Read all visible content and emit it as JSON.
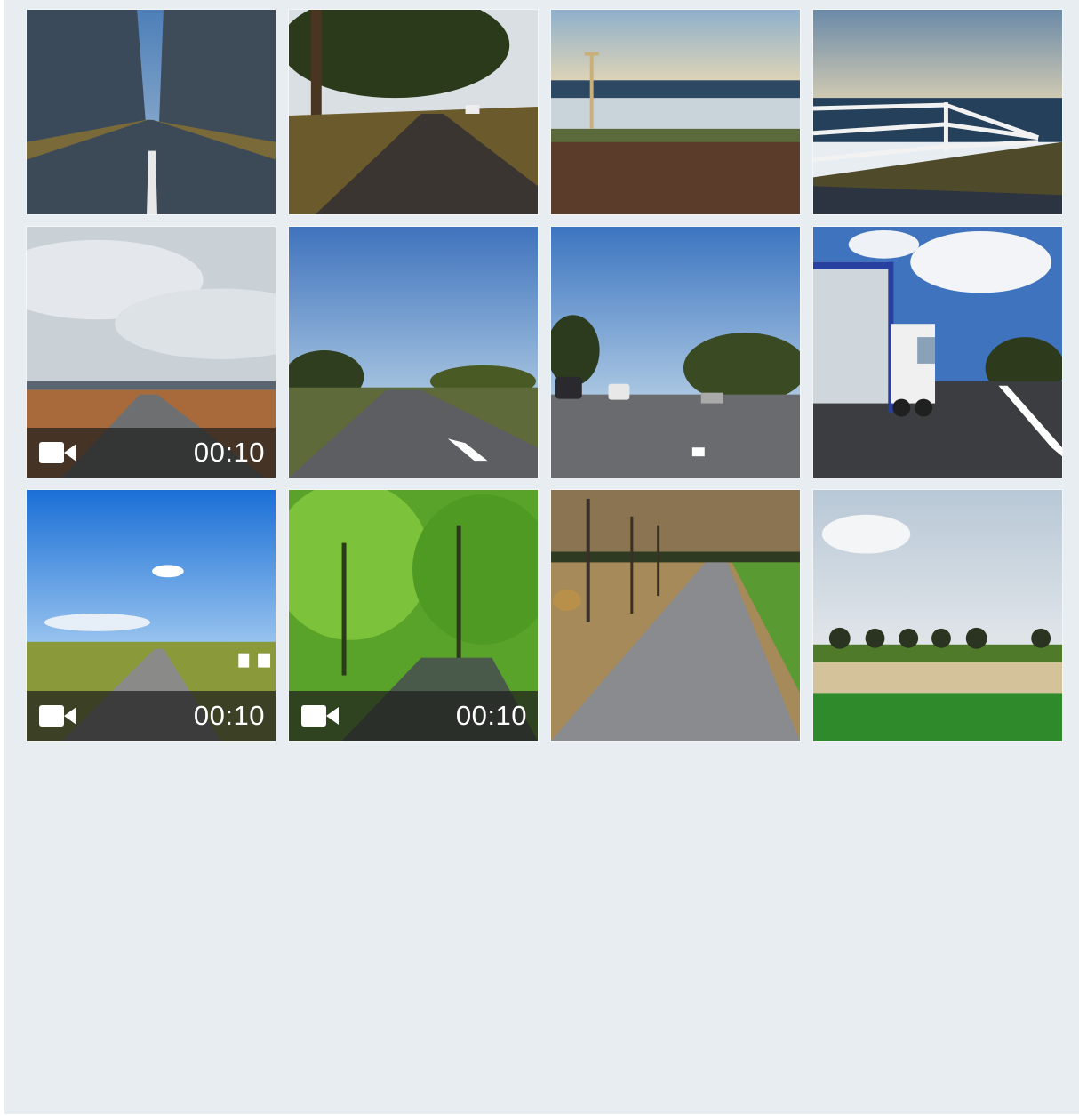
{
  "gallery": {
    "items": [
      {
        "scene": "foggy-forest-road",
        "type": "photo"
      },
      {
        "scene": "sunset-tree-road",
        "type": "photo"
      },
      {
        "scene": "ocean-shore-road",
        "type": "photo"
      },
      {
        "scene": "coastal-fence",
        "type": "photo"
      },
      {
        "scene": "cloudy-plain-road",
        "type": "video",
        "duration": "00:10"
      },
      {
        "scene": "blue-sky-highway",
        "type": "photo"
      },
      {
        "scene": "town-traffic-road",
        "type": "photo"
      },
      {
        "scene": "truck-highway",
        "type": "photo"
      },
      {
        "scene": "prairie-road",
        "type": "video",
        "duration": "00:10"
      },
      {
        "scene": "green-forest-road",
        "type": "video",
        "duration": "00:10"
      },
      {
        "scene": "hay-field-road",
        "type": "photo"
      },
      {
        "scene": "green-field-trees",
        "type": "photo"
      }
    ],
    "video_icon": "video-camera-icon"
  },
  "colors": {
    "background": "#e8edf2",
    "overlay": "#1e1e1e",
    "overlay_text": "#ffffff"
  }
}
